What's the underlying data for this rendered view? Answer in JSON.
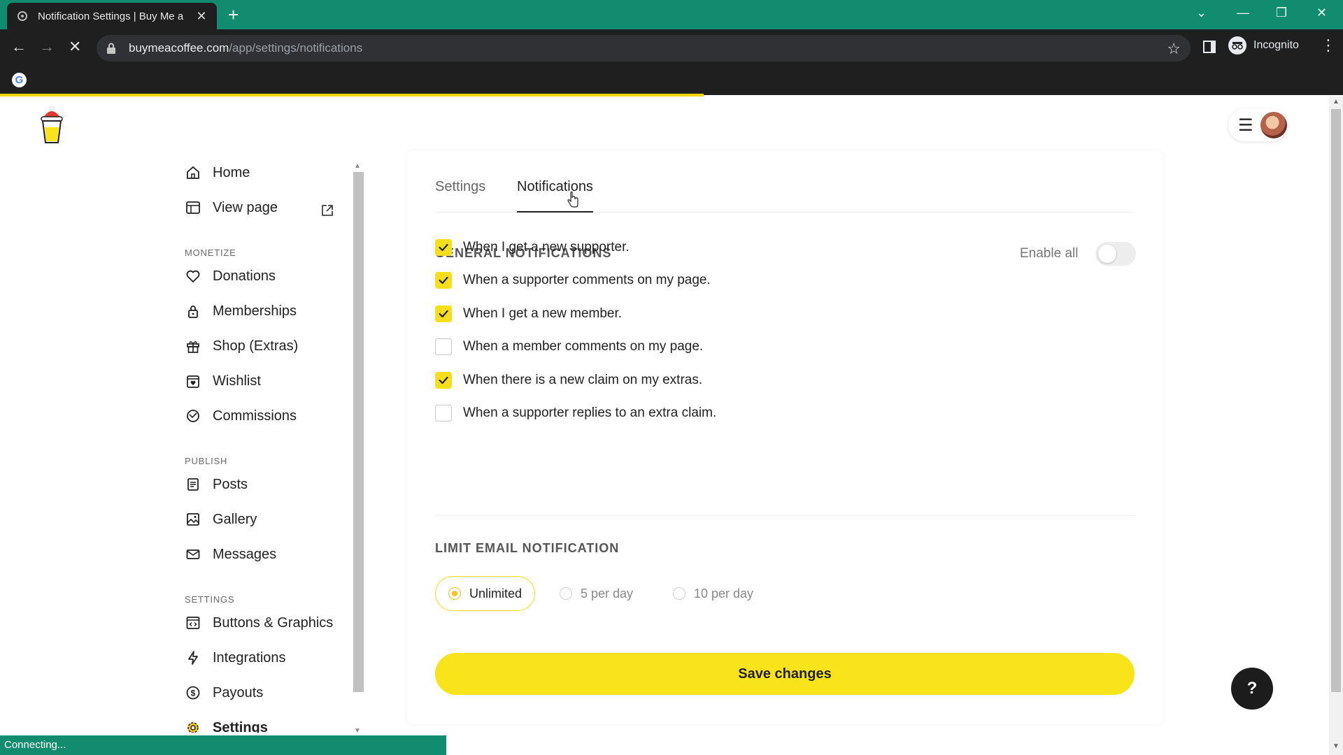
{
  "browser": {
    "tab_title": "Notification Settings | Buy Me a",
    "url_domain": "buymeacoffee.com",
    "url_path": "/app/settings/notifications",
    "incognito_label": "Incognito",
    "status_text": "Connecting..."
  },
  "sidebar": {
    "home": "Home",
    "view_page": "View page",
    "section_monetize": "MONETIZE",
    "donations": "Donations",
    "memberships": "Memberships",
    "shop": "Shop (Extras)",
    "wishlist": "Wishlist",
    "commissions": "Commissions",
    "section_publish": "PUBLISH",
    "posts": "Posts",
    "gallery": "Gallery",
    "messages": "Messages",
    "section_settings": "SETTINGS",
    "buttons_graphics": "Buttons & Graphics",
    "integrations": "Integrations",
    "payouts": "Payouts",
    "settings": "Settings"
  },
  "main": {
    "tabs": [
      {
        "label": "Settings",
        "active": false
      },
      {
        "label": "Notifications",
        "active": true
      }
    ],
    "general_title": "GENERAL NOTIFICATIONS",
    "enable_all_label": "Enable all",
    "enable_all_on": false,
    "notifications": [
      {
        "label": "When I get a new supporter.",
        "checked": true
      },
      {
        "label": "When a supporter comments on my page.",
        "checked": true
      },
      {
        "label": "When I get a new member.",
        "checked": true
      },
      {
        "label": "When a member comments on my page.",
        "checked": false
      },
      {
        "label": "When there is a new claim on my extras.",
        "checked": true
      },
      {
        "label": "When a supporter replies to an extra claim.",
        "checked": false
      }
    ],
    "limit_title": "LIMIT EMAIL NOTIFICATION",
    "limit_options": [
      {
        "label": "Unlimited",
        "selected": true
      },
      {
        "label": "5 per day",
        "selected": false
      },
      {
        "label": "10 per day",
        "selected": false
      }
    ],
    "save_label": "Save changes",
    "help_label": "?"
  },
  "colors": {
    "accent": "#f9e31a",
    "browser_frame": "#128c6e"
  }
}
